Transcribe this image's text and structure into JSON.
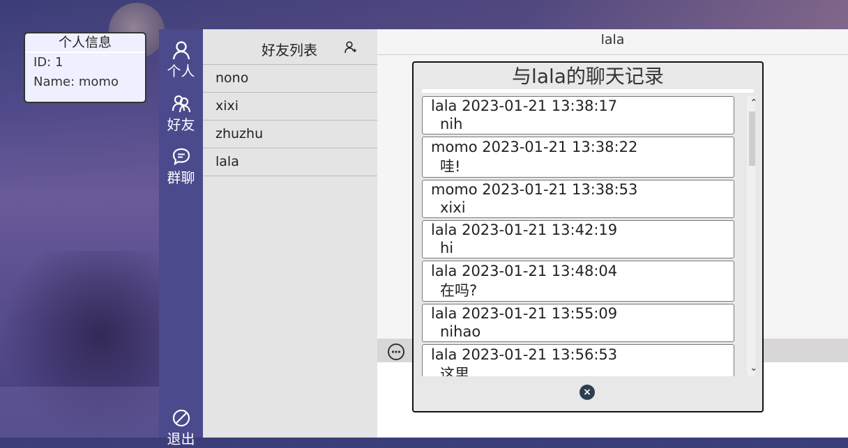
{
  "profile_card": {
    "title": "个人信息",
    "id_line": "ID: 1",
    "name_line": "Name: momo"
  },
  "nav": {
    "items": [
      {
        "label": "个人",
        "icon": "user-icon"
      },
      {
        "label": "好友",
        "icon": "friends-icon"
      },
      {
        "label": "群聊",
        "icon": "group-chat-icon"
      }
    ],
    "logout": {
      "label": "退出",
      "icon": "logout-icon"
    }
  },
  "friends": {
    "title": "好友列表",
    "add_icon": "add-friend-icon",
    "list": [
      "nono",
      "xixi",
      "zhuzhu",
      "lala"
    ]
  },
  "chat": {
    "header": "lala",
    "emoji_icon": "emoji-icon"
  },
  "history": {
    "title": "与lala的聊天记录",
    "messages": [
      {
        "header": "lala 2023-01-21 13:38:17",
        "text": "nih"
      },
      {
        "header": "momo 2023-01-21 13:38:22",
        "text": "哇!"
      },
      {
        "header": "momo 2023-01-21 13:38:53",
        "text": "xixi"
      },
      {
        "header": "lala 2023-01-21 13:42:19",
        "text": "hi"
      },
      {
        "header": "lala 2023-01-21 13:48:04",
        "text": "在吗?"
      },
      {
        "header": "lala 2023-01-21 13:55:09",
        "text": "nihao"
      },
      {
        "header": "lala 2023-01-21 13:56:53",
        "text": "这里"
      }
    ],
    "close_label": "×"
  },
  "colors": {
    "nav_bg": "#4a4a8c",
    "panel_bg": "#e4e4e4",
    "close_bg": "#2d3e50"
  }
}
